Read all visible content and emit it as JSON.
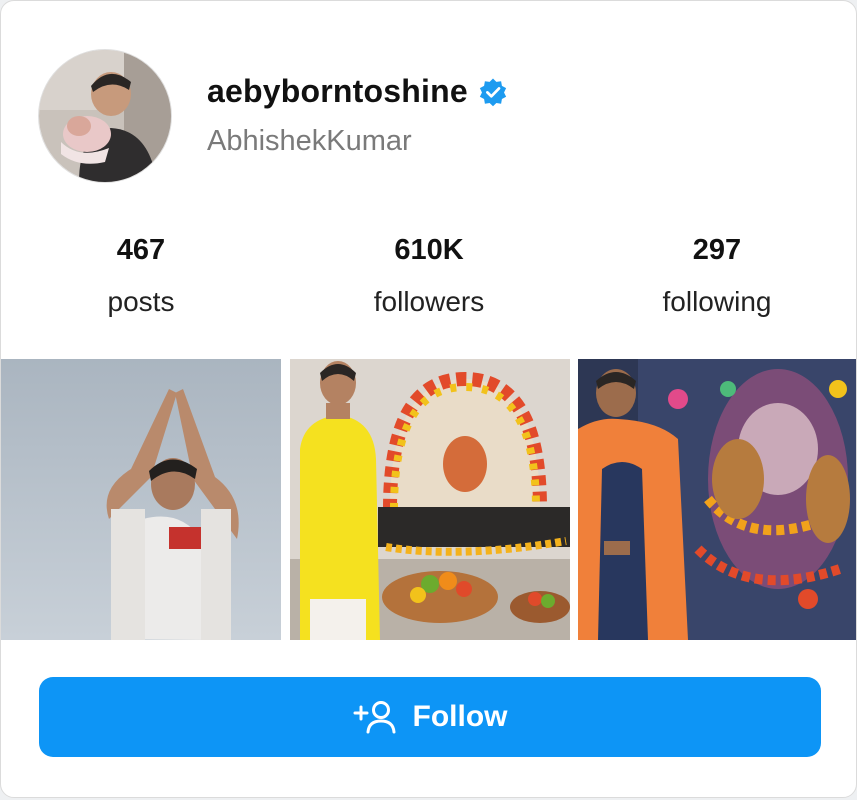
{
  "profile": {
    "username": "aebyborntoshine",
    "full_name": "AbhishekKumar",
    "verified": true,
    "avatar_icon": "profile-photo"
  },
  "stats": [
    {
      "value": "467",
      "label": "posts"
    },
    {
      "value": "610K",
      "label": "followers"
    },
    {
      "value": "297",
      "label": "following"
    }
  ],
  "posts": [
    {
      "icon": "photo-man-praying-in-fog"
    },
    {
      "icon": "photo-man-yellow-kurta-ganesh-altar"
    },
    {
      "icon": "photo-man-orange-shawl-ganesh-idol"
    }
  ],
  "follow": {
    "label": "Follow",
    "icon": "add-person-icon"
  },
  "colors": {
    "accent": "#0d95f6",
    "verified": "#1d9bf0",
    "text": "#111111",
    "muted": "#7a7a7a"
  }
}
